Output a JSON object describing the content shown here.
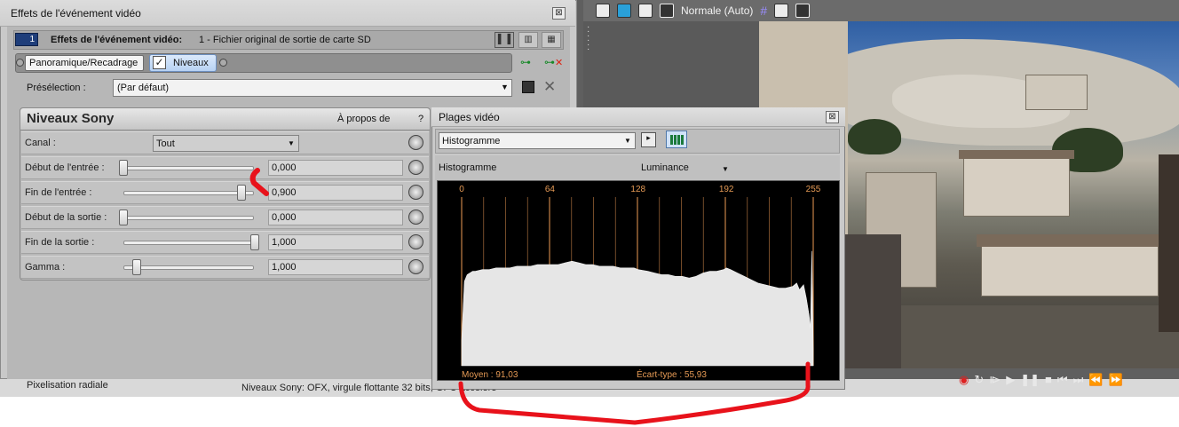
{
  "effects_window": {
    "title": "Effets de l'événement vidéo",
    "close_glyph": "⊠",
    "header": {
      "badge_number": "1",
      "label": "Effets de l'événement vidéo:",
      "value": "1 - Fichier original de sortie de carte SD"
    },
    "view_buttons": [
      "▌▐",
      "▥",
      "▦"
    ],
    "chain": {
      "tabs": [
        {
          "label": "Panoramique/Recadrage",
          "active": false
        },
        {
          "label": "Niveaux",
          "active": true,
          "checked": true
        }
      ],
      "check_glyph": "✓"
    },
    "preset": {
      "label": "Présélection :",
      "value": "(Par défaut)",
      "delete_glyph": "✕"
    },
    "plugin": {
      "title": "Niveaux Sony",
      "about_label": "À propos de",
      "help_label": "?",
      "channel": {
        "label": "Canal :",
        "value": "Tout"
      },
      "params": [
        {
          "label": "Début de l'entrée :",
          "value": "0,000",
          "level": 0.0
        },
        {
          "label": "Fin de l'entrée :",
          "value": "0,900",
          "level": 0.9
        },
        {
          "label": "Début de la sortie :",
          "value": "0,000",
          "level": 0.0
        },
        {
          "label": "Fin de la sortie :",
          "value": "1,000",
          "level": 1.0
        },
        {
          "label": "Gamma :",
          "value": "1,000",
          "level": 0.1
        }
      ]
    }
  },
  "scopes_window": {
    "title": "Plages vidéo",
    "close_glyph": "⊠",
    "scope_type": "Histogramme",
    "sub_label": "Histogramme",
    "channel": "Luminance",
    "chart_data": {
      "type": "area",
      "x_ticks": [
        "0",
        "64",
        "128",
        "192",
        "255"
      ],
      "xlim": [
        0,
        255
      ],
      "ylim": [
        0,
        1
      ],
      "x": [
        0,
        2,
        4,
        6,
        8,
        10,
        15,
        20,
        25,
        30,
        35,
        40,
        45,
        50,
        55,
        60,
        64,
        70,
        75,
        80,
        85,
        90,
        95,
        100,
        105,
        110,
        115,
        120,
        125,
        128,
        135,
        140,
        145,
        150,
        155,
        160,
        165,
        170,
        175,
        180,
        185,
        190,
        192,
        195,
        200,
        205,
        210,
        215,
        220,
        225,
        230,
        235,
        240,
        243,
        245,
        248,
        250,
        252,
        253,
        254,
        255
      ],
      "y": [
        0.15,
        0.5,
        0.54,
        0.55,
        0.56,
        0.56,
        0.57,
        0.57,
        0.58,
        0.58,
        0.58,
        0.59,
        0.59,
        0.59,
        0.6,
        0.6,
        0.6,
        0.6,
        0.61,
        0.62,
        0.61,
        0.6,
        0.6,
        0.59,
        0.59,
        0.59,
        0.58,
        0.58,
        0.58,
        0.57,
        0.56,
        0.55,
        0.54,
        0.54,
        0.53,
        0.53,
        0.52,
        0.53,
        0.55,
        0.56,
        0.56,
        0.57,
        0.58,
        0.57,
        0.55,
        0.53,
        0.51,
        0.49,
        0.48,
        0.47,
        0.46,
        0.46,
        0.47,
        0.49,
        0.45,
        0.48,
        0.4,
        0.3,
        0.22,
        0.68,
        0.1
      ],
      "stats": {
        "mean_label": "Moyen : 91,03",
        "stddev_label": "Écart-type : 55,93"
      }
    }
  },
  "host": {
    "display_mode": "Normale (Auto)",
    "bottom_left_text": "Pixelisation radiale",
    "bottom_mid_text": "Niveaux Sony: OFX, virgule flottante 32 bits, GPU accéléré"
  },
  "colors": {
    "accent_blue": "#1f3e7a",
    "histogram_fill": "#e6e6e6",
    "tick_line": "#d0884a",
    "tick_label": "#e59a55",
    "annotation_red": "#e8121b"
  }
}
